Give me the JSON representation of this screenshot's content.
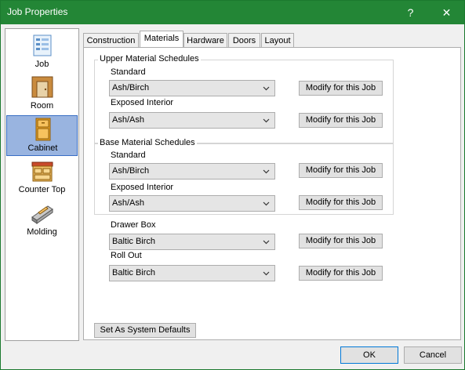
{
  "window": {
    "title": "Job Properties",
    "help_label": "?",
    "close_label": "✕"
  },
  "sidebar": {
    "items": [
      {
        "label": "Job",
        "icon": "job-icon"
      },
      {
        "label": "Room",
        "icon": "room-icon"
      },
      {
        "label": "Cabinet",
        "icon": "cabinet-icon",
        "selected": true
      },
      {
        "label": "Counter Top",
        "icon": "counter-top-icon"
      },
      {
        "label": "Molding",
        "icon": "molding-icon"
      }
    ]
  },
  "tabs": [
    {
      "label": "Construction"
    },
    {
      "label": "Materials",
      "active": true
    },
    {
      "label": "Hardware"
    },
    {
      "label": "Doors"
    },
    {
      "label": "Layout"
    }
  ],
  "upper": {
    "title": "Upper Material Schedules",
    "standard_label": "Standard",
    "standard_value": "Ash/Birch",
    "exposed_label": "Exposed Interior",
    "exposed_value": "Ash/Ash"
  },
  "base": {
    "title": "Base Material Schedules",
    "standard_label": "Standard",
    "standard_value": "Ash/Birch",
    "exposed_label": "Exposed Interior",
    "exposed_value": "Ash/Ash"
  },
  "drawer_box": {
    "label": "Drawer Box",
    "value": "Baltic Birch"
  },
  "roll_out": {
    "label": "Roll Out",
    "value": "Baltic Birch"
  },
  "modify_label": "Modify for this Job",
  "defaults_button": "Set As System Defaults",
  "footer": {
    "ok": "OK",
    "cancel": "Cancel"
  },
  "colors": {
    "titlebar": "#238636",
    "selection": "#99b4e0"
  }
}
